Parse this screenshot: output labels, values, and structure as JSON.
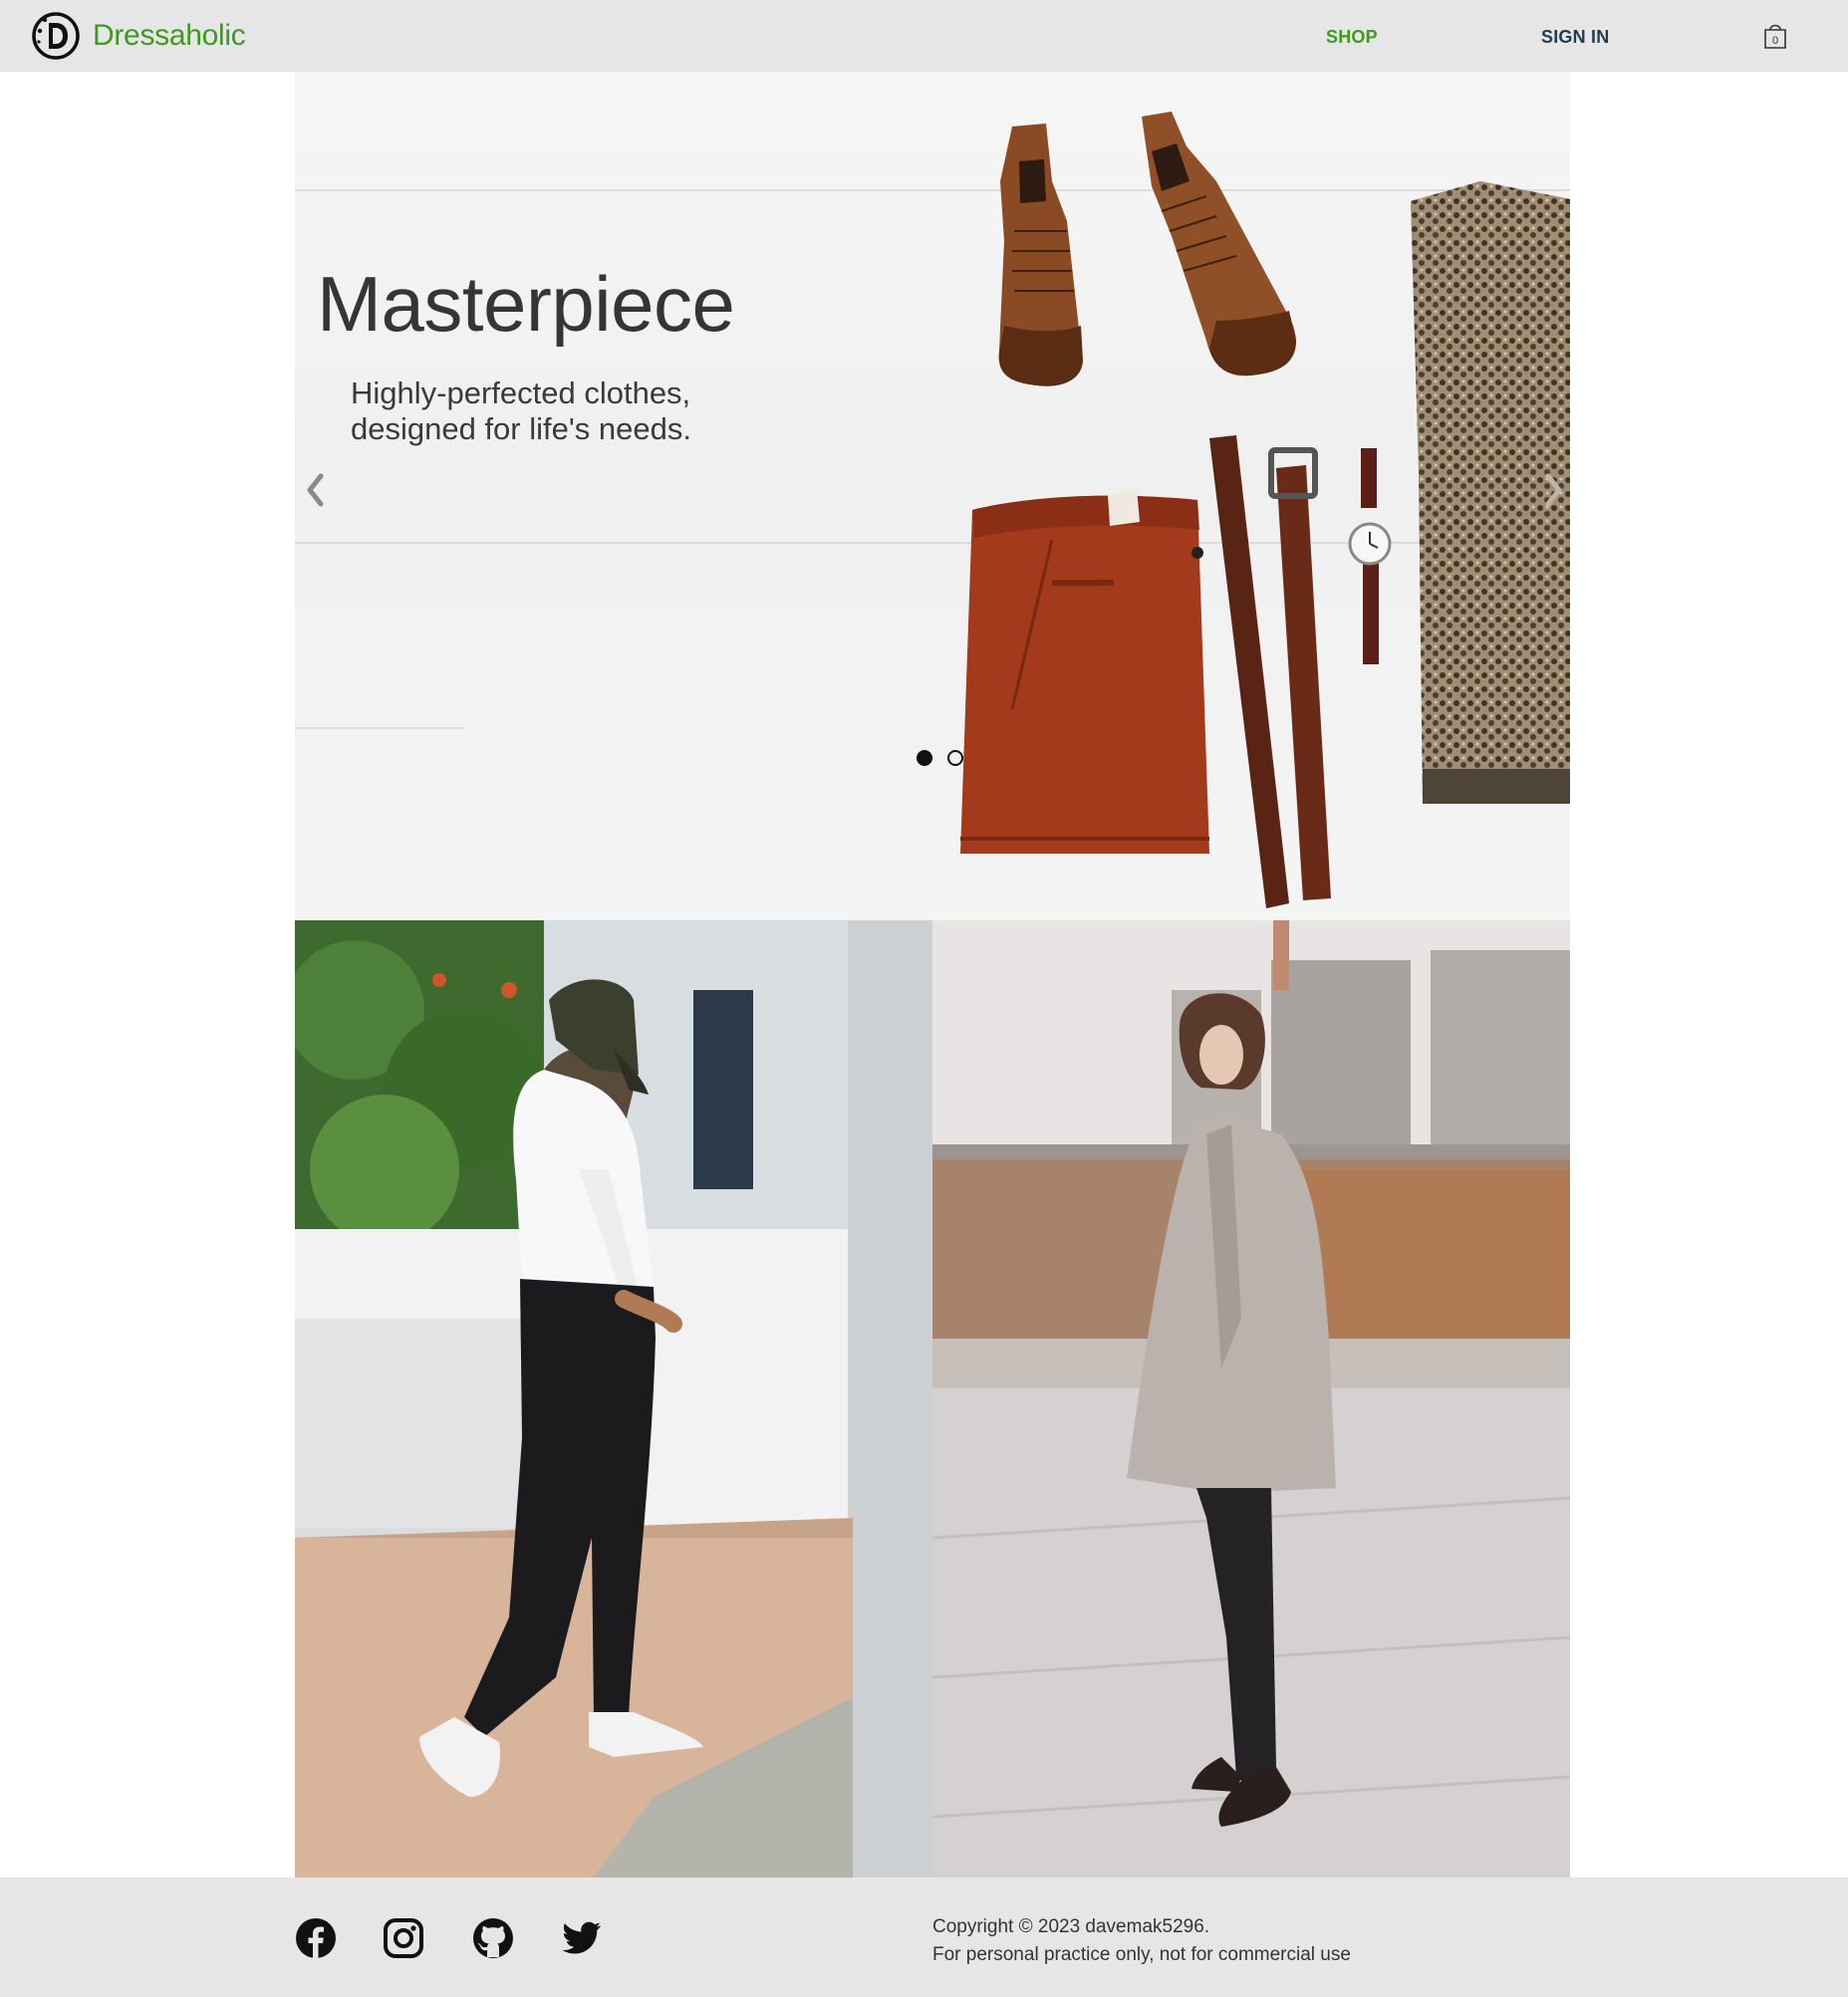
{
  "header": {
    "brand": "Dressaholic",
    "nav": {
      "shop": "SHOP",
      "sign_in": "SIGN IN"
    },
    "cart_count": "0",
    "icons": {
      "logo": "dressaholic-logo-icon",
      "cart": "shopping-bag-icon"
    }
  },
  "hero": {
    "title": "Masterpiece",
    "subtitle_line1": "Highly-perfected clothes,",
    "subtitle_line2": "designed for life's needs.",
    "slides_total": 2,
    "active_slide": 1,
    "icons": {
      "prev": "chevron-left-icon",
      "next": "chevron-right-icon"
    }
  },
  "tiles": [
    {
      "name": "man-in-white-shirt-photo"
    },
    {
      "name": "woman-in-grey-coat-photo"
    }
  ],
  "footer": {
    "social": [
      "facebook-icon",
      "instagram-icon",
      "github-icon",
      "twitter-icon"
    ],
    "copyright": "Copyright © 2023 davemak5296.",
    "note": "For personal practice only, not for commercial use"
  },
  "colors": {
    "brand_green": "#3d9a1d",
    "nav_dark": "#1f3c52",
    "bar_bg": "#e6e6e6"
  }
}
